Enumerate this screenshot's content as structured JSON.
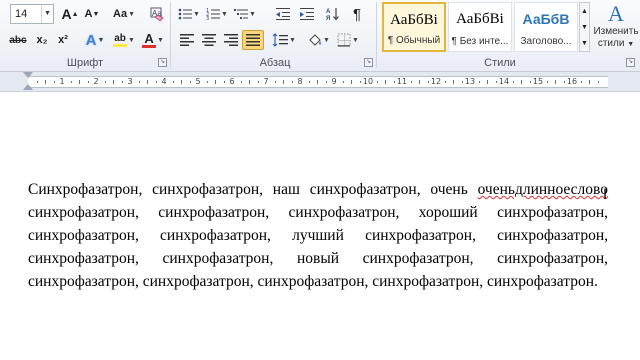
{
  "ribbon": {
    "font_group": {
      "label": "Шрифт",
      "font_size": "14",
      "grow_font": "A",
      "shrink_font": "A",
      "change_case": "Aa",
      "strikethrough": "abc",
      "subscript": "x₂",
      "superscript": "x²",
      "text_effects": "A",
      "highlight": "ab",
      "font_color": "A",
      "font_color_value": "#e03030",
      "highlight_color_value": "#ffe84a"
    },
    "paragraph_group": {
      "label": "Абзац",
      "show_marks": "¶"
    },
    "styles_group": {
      "label": "Стили",
      "tiles": [
        {
          "preview": "АаБбВі",
          "name": "¶ Обычный",
          "selected": true
        },
        {
          "preview": "АаБбВі",
          "name": "¶ Без инте...",
          "selected": false
        },
        {
          "preview": "АаБбВ",
          "name": "Заголово...",
          "selected": false
        }
      ],
      "change_styles": "Изменить стили",
      "change_styles_line1": "Изменить",
      "change_styles_line2": "стили"
    }
  },
  "ruler": {
    "numbers": [
      "1",
      "2",
      "3",
      "4",
      "5",
      "6",
      "7",
      "8",
      "9",
      "10",
      "11",
      "12",
      "13",
      "14",
      "15",
      "16"
    ]
  },
  "document": {
    "segments": [
      {
        "text": "Синхрофазатрон, синхрофазатрон, наш синхрофазатрон, очень ",
        "misspelled": false
      },
      {
        "text": "оченьдлинноеслово",
        "misspelled": true
      },
      {
        "text": " синхрофазатрон, синхрофазатрон, синхрофазатрон, хороший синхрофазатрон, синхрофазатрон, синхрофазатрон, лучший синхрофазатрон, синхрофазатрон, синхрофазатрон, синхрофазатрон, новый синхрофазатрон, синхрофазатрон, синхрофазатрон, синхрофазатрон, синхрофазатрон, синхрофазатрон, синхрофазатрон.",
        "misspelled": false
      }
    ]
  }
}
